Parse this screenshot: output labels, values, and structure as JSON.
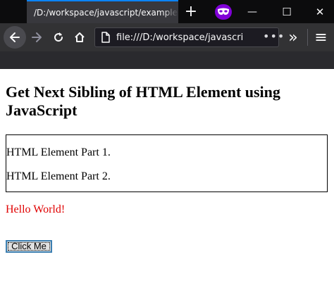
{
  "browser": {
    "tab_title": "/D:/workspace/javascript/example.html",
    "new_tab_symbol": "+",
    "url": "file:///D:/workspace/javascript/example.html",
    "url_more": "•••",
    "overflow_symbol": "»",
    "menu_symbol": "≡",
    "window_controls": {
      "minimize": "—",
      "maximize": "☐",
      "close": "✕"
    }
  },
  "page": {
    "heading": "Get Next Sibling of HTML Element using JavaScript",
    "paragraphs": [
      "HTML Element Part 1.",
      "HTML Element Part 2."
    ],
    "output_text": "Hello World!",
    "button_label": "Click Me"
  },
  "colors": {
    "tab_active_accent": "#0a84ff",
    "private_badge": "#8000d7",
    "output_text": "#e00000"
  },
  "icons": {
    "back": "back-arrow-icon",
    "forward": "forward-arrow-icon",
    "reload": "reload-icon",
    "home": "home-icon",
    "page": "page-icon",
    "private": "private-browsing-mask-icon"
  }
}
